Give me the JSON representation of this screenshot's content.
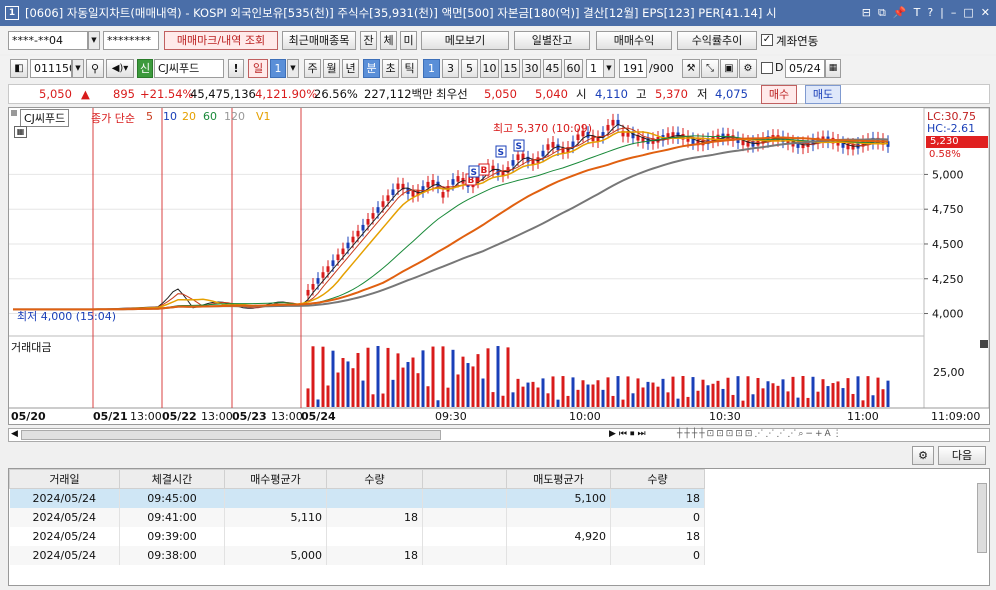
{
  "window": {
    "title": "[0606] 자동일지차트(매매내역) - KOSPI 외국인보유[535(천)] 주식수[35,931(천)] 액면[500] 자본금[180(억)] 결산[12월] EPS[123] PER[41.14] 시",
    "icon_label": "1"
  },
  "account": {
    "account_no": "****-**04",
    "password": "********",
    "btn_trade_mark": "매매마크/내역 조회",
    "btn_recent": "최근매매종목",
    "btn_jan": "잔",
    "btn_che": "체",
    "btn_mi": "미",
    "btn_memo": "메모보기",
    "btn_daily_balance": "일별잔고",
    "btn_trade_profit": "매매수익",
    "btn_profit_trend": "수익률추이",
    "chk_account_link": "계좌연동"
  },
  "toolbar": {
    "stock_code": "011150",
    "market_badge": "신",
    "stock_name": "CJ씨푸드",
    "period_buttons": [
      "일",
      "1",
      "주",
      "월",
      "년",
      "분",
      "초",
      "틱"
    ],
    "minute_values": [
      "1",
      "3",
      "5",
      "10",
      "15",
      "30",
      "45",
      "60"
    ],
    "interval_value": "1",
    "count_value": "191",
    "count_total": "/900",
    "chk_d_label": "D",
    "date_value": "05/24"
  },
  "quote": {
    "price": "5,050",
    "change_arrow": "▲",
    "change": "895",
    "change_rate": "+21.54%",
    "volume": "45,475,136",
    "volume_rate": "4,121.90%",
    "turnover": "26.56%",
    "amount": "227,112백만",
    "best_bid_label": "최우선",
    "best_ask": "5,050",
    "best_bid": "5,040",
    "open_label": "시",
    "open": "4,110",
    "high_label": "고",
    "high": "5,370",
    "low_label": "저",
    "low": "4,075",
    "buy_label": "매수",
    "sell_label": "매도"
  },
  "chart_data": {
    "type": "candlestick",
    "legend": {
      "name": "CJ씨푸드",
      "series": "종가 단순",
      "ma": [
        "5",
        "10",
        "20",
        "60",
        "120"
      ],
      "extra": "V1"
    },
    "yaxis": {
      "ticks": [
        "5,000",
        "4,750",
        "4,500",
        "4,250",
        "4,000"
      ],
      "lc": "LC:30.75",
      "hc": "HC:-2.61",
      "current": "5,230",
      "pct": "0.58%"
    },
    "annotations": {
      "high": "최고 5,370 (10:09)",
      "low": "최저 4,000 (15:04)"
    },
    "volume": {
      "title": "거래대금",
      "tick": "25,00"
    },
    "xaxis": {
      "labels": [
        "05/20",
        "05/21",
        "13:00",
        "05/22",
        "13:00",
        "05/23",
        "13:00",
        "05/24",
        "09:30",
        "10:00",
        "10:30",
        "11:00",
        "11:09:00"
      ]
    },
    "trade_marks": [
      "B",
      "B",
      "S",
      "S",
      "S"
    ]
  },
  "bottom": {
    "next_label": "다음",
    "columns": [
      "거래일",
      "체결시간",
      "매수평균가",
      "수량",
      "",
      "매도평균가",
      "수량"
    ],
    "rows": [
      [
        "2024/05/24",
        "09:45:00",
        "",
        "",
        "",
        "5,100",
        "18"
      ],
      [
        "2024/05/24",
        "09:41:00",
        "5,110",
        "18",
        "",
        "",
        "0"
      ],
      [
        "2024/05/24",
        "09:39:00",
        "",
        "",
        "",
        "4,920",
        "18"
      ],
      [
        "2024/05/24",
        "09:38:00",
        "5,000",
        "18",
        "",
        "",
        "0"
      ]
    ]
  },
  "colors": {
    "title_bar": "#4a6ea8",
    "up": "#d81b1b",
    "down": "#1a3fb8",
    "ma5": "#222222",
    "ma10": "#c83c1e",
    "ma20": "#e5a000",
    "ma60": "#1a8a3a",
    "ma120": "#777777"
  }
}
